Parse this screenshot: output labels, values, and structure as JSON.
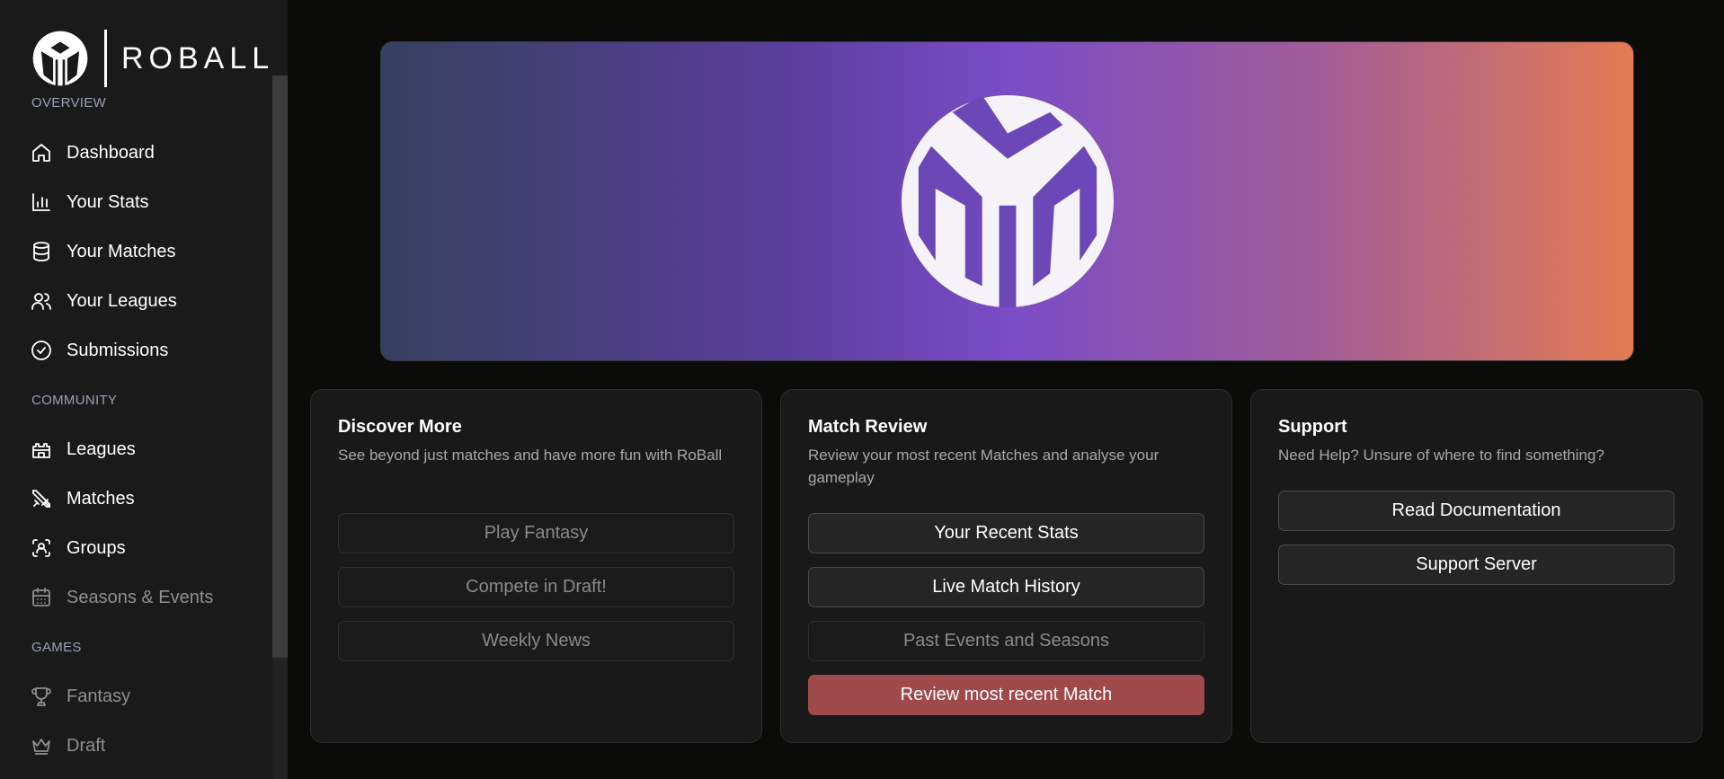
{
  "brand": {
    "name": "ROBALL"
  },
  "sidebar": {
    "sections": [
      {
        "label": "OVERVIEW",
        "items": [
          {
            "label": "Dashboard",
            "icon": "home-icon"
          },
          {
            "label": "Your Stats",
            "icon": "bar-chart-icon"
          },
          {
            "label": "Your Matches",
            "icon": "database-icon"
          },
          {
            "label": "Your Leagues",
            "icon": "users-icon"
          },
          {
            "label": "Submissions",
            "icon": "check-circle-icon"
          }
        ]
      },
      {
        "label": "COMMUNITY",
        "items": [
          {
            "label": "Leagues",
            "icon": "castle-icon"
          },
          {
            "label": "Matches",
            "icon": "swords-icon"
          },
          {
            "label": "Groups",
            "icon": "scan-group-icon"
          },
          {
            "label": "Seasons & Events",
            "icon": "calendar-icon"
          }
        ]
      },
      {
        "label": "GAMES",
        "items": [
          {
            "label": "Fantasy",
            "icon": "trophy-icon"
          },
          {
            "label": "Draft",
            "icon": "crown-icon"
          }
        ]
      }
    ]
  },
  "cards": [
    {
      "title": "Discover More",
      "description": "See beyond just matches and have more fun with RoBall",
      "buttons": [
        "Play Fantasy",
        "Compete in Draft!",
        "Weekly News"
      ]
    },
    {
      "title": "Match Review",
      "description": "Review your most recent Matches and analyse your gameplay",
      "buttons": [
        "Your Recent Stats",
        "Live Match History",
        "Past Events and Seasons",
        "Review most recent Match"
      ]
    },
    {
      "title": "Support",
      "description": "Need Help? Unsure of where to find something?",
      "buttons": [
        "Read Documentation",
        "Support Server"
      ]
    }
  ],
  "colors": {
    "accent_danger": "#a0494a",
    "hero_gradient_start": "#36405e",
    "hero_gradient_mid": "#7a4cc6",
    "hero_gradient_end": "#e37b52"
  }
}
